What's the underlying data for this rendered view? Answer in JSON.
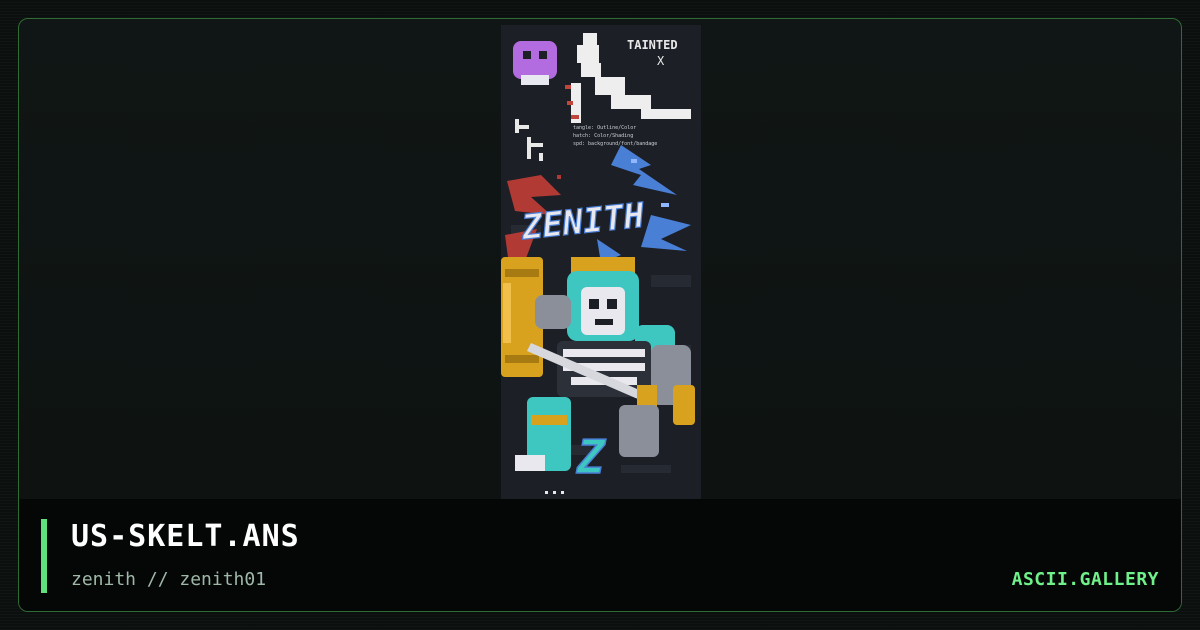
{
  "artwork": {
    "title": "US-SKELT.ANS",
    "credit": "zenith // zenith01",
    "preview": {
      "badge_text": "TAINTED",
      "badge_mark": "X",
      "legend_lines": [
        "tangle: Outline/Color",
        "hatch: Color/Shading",
        "spd: background/font/bandage"
      ],
      "logo_text": "ZENITH",
      "emblem_letter": "Z"
    }
  },
  "brand": {
    "label": "ASCII.GALLERY"
  },
  "colors": {
    "accent": "#5fe07a",
    "frame_border": "#2f6b34",
    "art_cyan": "#3ec6c0",
    "art_gold": "#d8a11e",
    "art_purple": "#b36be0",
    "art_red": "#b23a34",
    "art_blue": "#4a7fd6"
  }
}
